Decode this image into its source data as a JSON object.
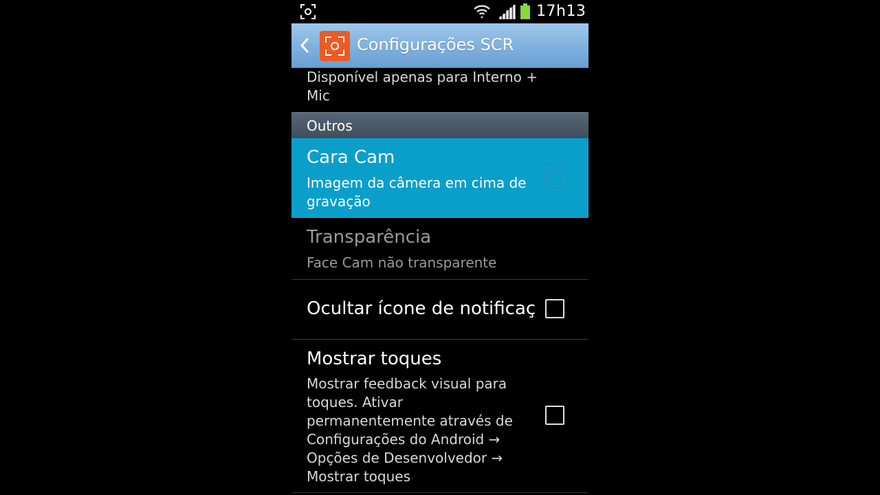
{
  "status_bar": {
    "time": "17h13"
  },
  "action_bar": {
    "title": "Configurações SCR"
  },
  "prev_item": {
    "summary_line1": "Disponível apenas para Interno +",
    "summary_line2": "Mic"
  },
  "section": {
    "label": "Outros"
  },
  "items": [
    {
      "title": "Cara Cam",
      "summary_line1": "Imagem da câmera em cima de",
      "summary_line2": "gravação",
      "checked": false,
      "highlighted": true
    },
    {
      "title": "Transparência",
      "summary_line1": "Face Cam não transparente",
      "enabled": false
    },
    {
      "title": "Ocultar ícone de notificação",
      "checked": false
    },
    {
      "title": "Mostrar toques",
      "summary_lines": [
        "Mostrar feedback visual para",
        "toques. Ativar",
        "permanentemente através de",
        "Configurações do Android →",
        "Opções de Desenvolvedor →",
        "Mostrar toques"
      ],
      "checked": false
    }
  ],
  "colors": {
    "highlight": "#0a9fca",
    "action_bar": "#7fb0de",
    "app_icon": "#ee5a24",
    "battery": "#8bd63a"
  }
}
